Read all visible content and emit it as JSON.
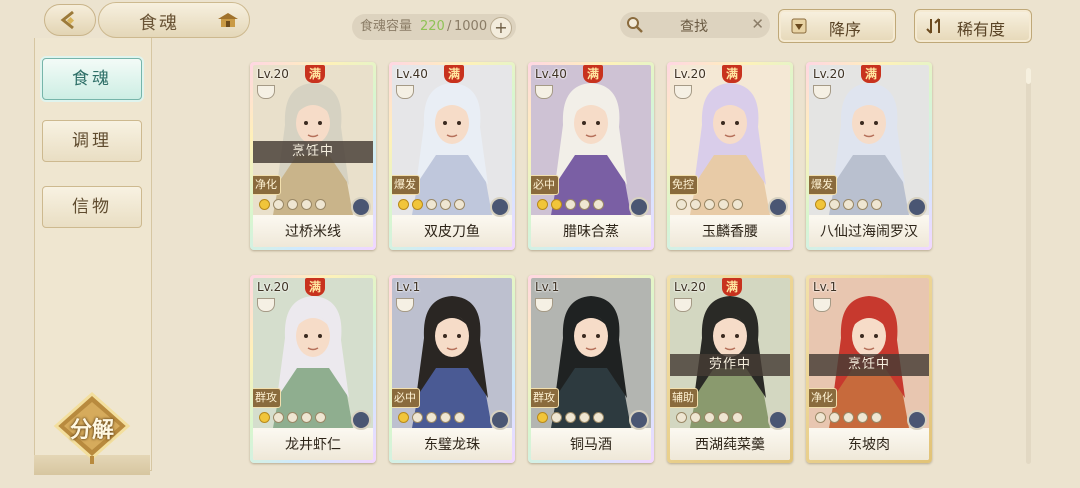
{
  "header": {
    "title": "食魂",
    "capacity_label": "食魂容量",
    "capacity_current": "220",
    "capacity_sep": "/",
    "capacity_max": "1000",
    "search_placeholder": "查找",
    "sort_label": "降序",
    "rarity_label": "稀有度"
  },
  "sidebar": {
    "tabs": [
      {
        "label": "食魂",
        "active": true
      },
      {
        "label": "调理",
        "active": false
      },
      {
        "label": "信物",
        "active": false
      }
    ],
    "decompose_label": "分解"
  },
  "cards": [
    {
      "level": "Lv.20",
      "max": "满",
      "status": "烹饪中",
      "role": "净化",
      "stars": 5,
      "lit": 1,
      "name": "过桥米线",
      "theme": "#c9b48a",
      "hair": "#d6d2c2",
      "gold": false
    },
    {
      "level": "Lv.40",
      "max": "满",
      "status": "",
      "role": "爆发",
      "stars": 5,
      "lit": 2,
      "name": "双皮刀鱼",
      "theme": "#bfc7dc",
      "hair": "#e9eef5",
      "gold": false
    },
    {
      "level": "Lv.40",
      "max": "满",
      "status": "",
      "role": "必中",
      "stars": 5,
      "lit": 2,
      "name": "腊味合蒸",
      "theme": "#7a5fa4",
      "hair": "#f2efe8",
      "gold": false
    },
    {
      "level": "Lv.20",
      "max": "满",
      "status": "",
      "role": "免控",
      "stars": 5,
      "lit": 0,
      "name": "玉麟香腰",
      "theme": "#e8cba7",
      "hair": "#d9cdea",
      "gold": false
    },
    {
      "level": "Lv.20",
      "max": "满",
      "status": "",
      "role": "爆发",
      "stars": 5,
      "lit": 1,
      "name": "八仙过海闹罗汉",
      "theme": "#b9c0cf",
      "hair": "#dfe4ef",
      "gold": false
    },
    {
      "level": "Lv.20",
      "max": "满",
      "status": "",
      "role": "群攻",
      "stars": 5,
      "lit": 1,
      "name": "龙井虾仁",
      "theme": "#8fae8f",
      "hair": "#ece9ee",
      "gold": false
    },
    {
      "level": "Lv.1",
      "max": "",
      "status": "",
      "role": "必中",
      "stars": 5,
      "lit": 1,
      "name": "东璧龙珠",
      "theme": "#4a5a94",
      "hair": "#2a2623",
      "gold": false
    },
    {
      "level": "Lv.1",
      "max": "",
      "status": "",
      "role": "群攻",
      "stars": 5,
      "lit": 1,
      "name": "铜马酒",
      "theme": "#2d3a3f",
      "hair": "#1f2222",
      "gold": false
    },
    {
      "level": "Lv.20",
      "max": "满",
      "status": "劳作中",
      "role": "辅助",
      "stars": 5,
      "lit": 0,
      "name": "西湖莼菜羹",
      "theme": "#8a9a6e",
      "hair": "#2a2a26",
      "gold": true
    },
    {
      "level": "Lv.1",
      "max": "",
      "status": "烹饪中",
      "role": "净化",
      "stars": 5,
      "lit": 0,
      "name": "东坡肉",
      "theme": "#c76a3c",
      "hair": "#c7392e",
      "gold": true
    }
  ]
}
